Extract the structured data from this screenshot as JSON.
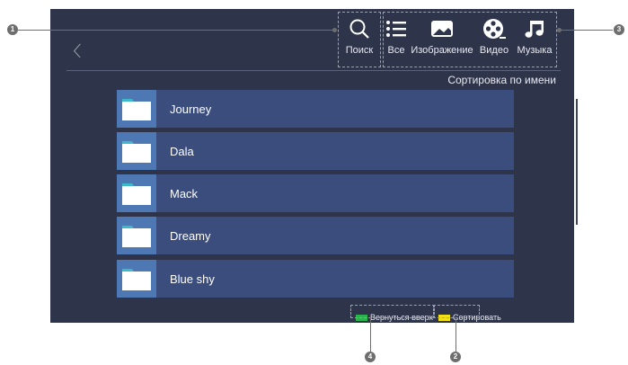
{
  "header": {
    "search_label": "Поиск",
    "tabs": [
      {
        "label": "Все",
        "icon": "list-icon"
      },
      {
        "label": "Изображение",
        "icon": "image-icon"
      },
      {
        "label": "Видео",
        "icon": "film-reel-icon"
      },
      {
        "label": "Музыка",
        "icon": "music-note-icon"
      }
    ]
  },
  "sort_status": "Сортировка по имени",
  "folders": [
    {
      "name": "Journey"
    },
    {
      "name": "Dala"
    },
    {
      "name": "Mack"
    },
    {
      "name": "Dreamy"
    },
    {
      "name": "Blue shy"
    }
  ],
  "footer": {
    "back_to_top": "Вернуться вверх",
    "sort": "Сортировать",
    "green_key_color": "#2bb24c",
    "yellow_key_color": "#f3e21b"
  },
  "callouts": [
    "1",
    "2",
    "3",
    "4"
  ],
  "colors": {
    "screen_bg": "#2e3449",
    "row_bg": "#3a4d7d",
    "folder_tile": "#4d78b3"
  }
}
